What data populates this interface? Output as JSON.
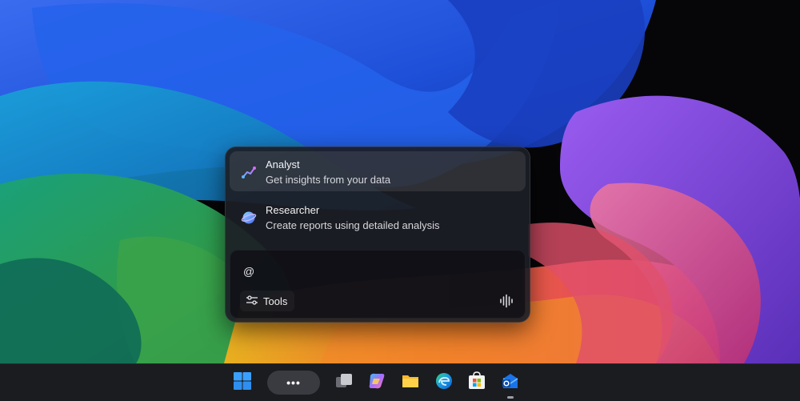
{
  "agents": [
    {
      "name": "Analyst",
      "description": "Get insights from your data",
      "icon": "analyst-icon",
      "selected": true
    },
    {
      "name": "Researcher",
      "description": "Create reports using detailed analysis",
      "icon": "researcher-icon",
      "selected": false
    }
  ],
  "composer": {
    "input_value": "@",
    "tools_label": "Tools",
    "tools_icon": "sliders-icon",
    "voice_icon": "voice-waveform-icon"
  },
  "taskbar": {
    "more_label": "•••",
    "apps": [
      "start-icon",
      "task-view-icon",
      "copilot-icon",
      "file-explorer-icon",
      "edge-icon",
      "store-icon",
      "outlook-icon"
    ]
  },
  "colors": {
    "popup_bg": "#1c1e26",
    "taskbar_bg": "#1b1c20",
    "analyst_accent": "#b06bff",
    "windows_blue": "#1e90ff"
  }
}
